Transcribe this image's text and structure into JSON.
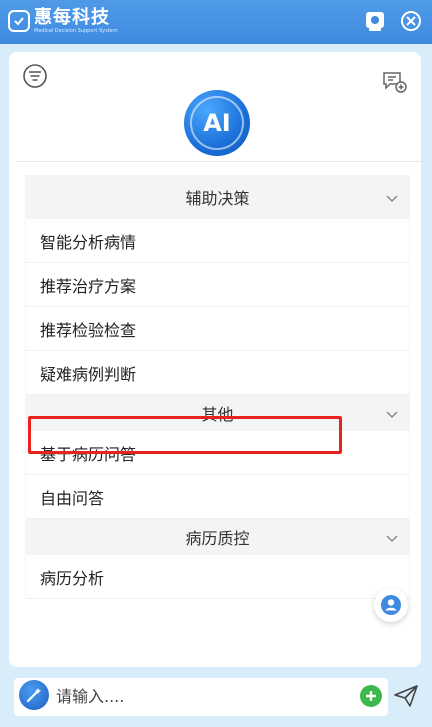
{
  "window": {
    "brand_title": "惠每科技",
    "brand_subtitle": "Medical Decision Support System"
  },
  "menu": {
    "sections": [
      {
        "title": "辅助决策",
        "items": [
          "智能分析病情",
          "推荐治疗方案",
          "推荐检验检查",
          "疑难病例判断"
        ]
      },
      {
        "title": "其他",
        "items": [
          "基于病历问答",
          "自由问答"
        ]
      },
      {
        "title": "病历质控",
        "items": [
          "病历分析"
        ]
      }
    ]
  },
  "avatar": {
    "text": "AI"
  },
  "input": {
    "placeholder": "请输入...."
  },
  "colors": {
    "titlebar": "#4a95e6",
    "highlight": "#e8231f",
    "add": "#3db84a"
  }
}
